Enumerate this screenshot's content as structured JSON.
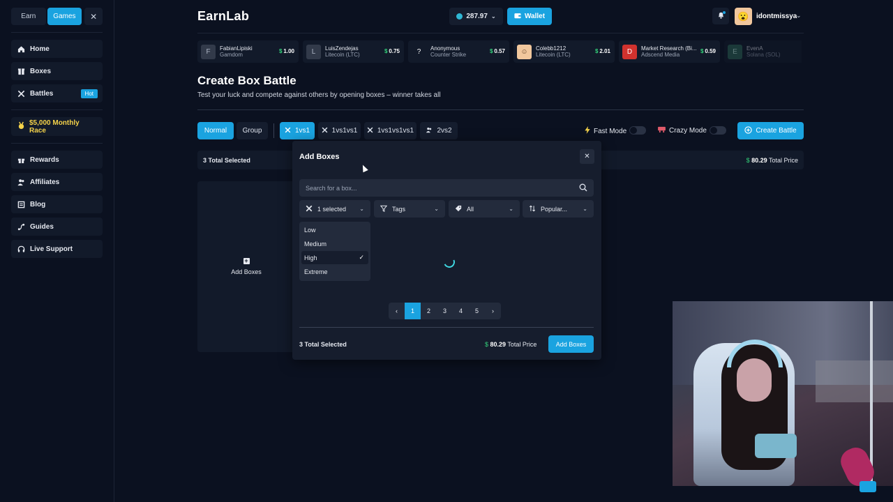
{
  "sidebar": {
    "tabs": [
      {
        "label": "Earn",
        "active": false
      },
      {
        "label": "Games",
        "active": true
      }
    ],
    "close_glyph": "✕",
    "nav": [
      {
        "label": "Home",
        "icon": "home-icon"
      },
      {
        "label": "Boxes",
        "icon": "box-icon"
      },
      {
        "label": "Battles",
        "icon": "swords-icon",
        "badge": "Hot"
      }
    ],
    "race": {
      "label": "$5,000 Monthly Race",
      "icon": "medal-icon"
    },
    "nav2": [
      {
        "label": "Rewards",
        "icon": "gift-icon"
      },
      {
        "label": "Affiliates",
        "icon": "users-icon"
      },
      {
        "label": "Blog",
        "icon": "newspaper-icon"
      },
      {
        "label": "Guides",
        "icon": "route-icon"
      },
      {
        "label": "Live Support",
        "icon": "headset-icon"
      }
    ]
  },
  "header": {
    "logo": "EarnLab",
    "balance": "287.97",
    "wallet_label": "Wallet",
    "username": "idontmissya"
  },
  "feed": [
    {
      "initial": "F",
      "name": "FabianLipiski",
      "source": "Gamdom",
      "amount": "1.00"
    },
    {
      "initial": "L",
      "name": "LuisZendejas",
      "source": "Litecoin (LTC)",
      "amount": "0.75"
    },
    {
      "initial": "?",
      "name": "Anonymous",
      "source": "Counter Strike",
      "amount": "0.57"
    },
    {
      "initial": "☺",
      "name": "Colebb1212",
      "source": "Litecoin (LTC)",
      "amount": "2.01"
    },
    {
      "initial": "D",
      "name": "Market Research (Bi...",
      "source": "Adscend Media",
      "amount": "0.59"
    },
    {
      "initial": "E",
      "name": "EvenA",
      "source": "Solana (SOL)",
      "amount": ""
    }
  ],
  "page": {
    "title": "Create Box Battle",
    "subtitle": "Test your luck and compete against others by opening boxes – winner takes all"
  },
  "modes": {
    "type_tabs": [
      {
        "label": "Normal",
        "active": true
      },
      {
        "label": "Group",
        "active": false
      }
    ],
    "size_tabs": [
      {
        "label": "1vs1",
        "active": true
      },
      {
        "label": "1vs1vs1",
        "active": false
      },
      {
        "label": "1vs1vs1vs1",
        "active": false
      },
      {
        "label": "2vs2",
        "active": false
      }
    ],
    "fast_mode": "Fast Mode",
    "crazy_mode": "Crazy Mode",
    "create_label": "Create Battle"
  },
  "summary": {
    "selected": "3 Total Selected",
    "price_symbol": "$",
    "price": "80.29",
    "price_label": "Total Price"
  },
  "add_tile": {
    "label": "Add Boxes"
  },
  "modal": {
    "title": "Add Boxes",
    "search_placeholder": "Search for a box...",
    "filters": [
      {
        "label": "1 selected",
        "icon": "swords-icon"
      },
      {
        "label": "Tags",
        "icon": "filter-icon"
      },
      {
        "label": "All",
        "icon": "tag-icon"
      },
      {
        "label": "Popular...",
        "icon": "sort-icon"
      }
    ],
    "risk_options": [
      {
        "label": "Low",
        "selected": false
      },
      {
        "label": "Medium",
        "selected": false
      },
      {
        "label": "High",
        "selected": true
      },
      {
        "label": "Extreme",
        "selected": false
      }
    ],
    "pages": [
      "1",
      "2",
      "3",
      "4",
      "5"
    ],
    "current_page": "1",
    "footer_selected": "3 Total Selected",
    "footer_price_symbol": "$",
    "footer_price": "80.29",
    "footer_price_label": "Total Price",
    "add_label": "Add Boxes"
  },
  "colors": {
    "accent": "#1aa3e0",
    "background": "#0b1120",
    "panel": "#121a2a",
    "price_green": "#33d17a",
    "race_gold": "#f4d24a"
  }
}
